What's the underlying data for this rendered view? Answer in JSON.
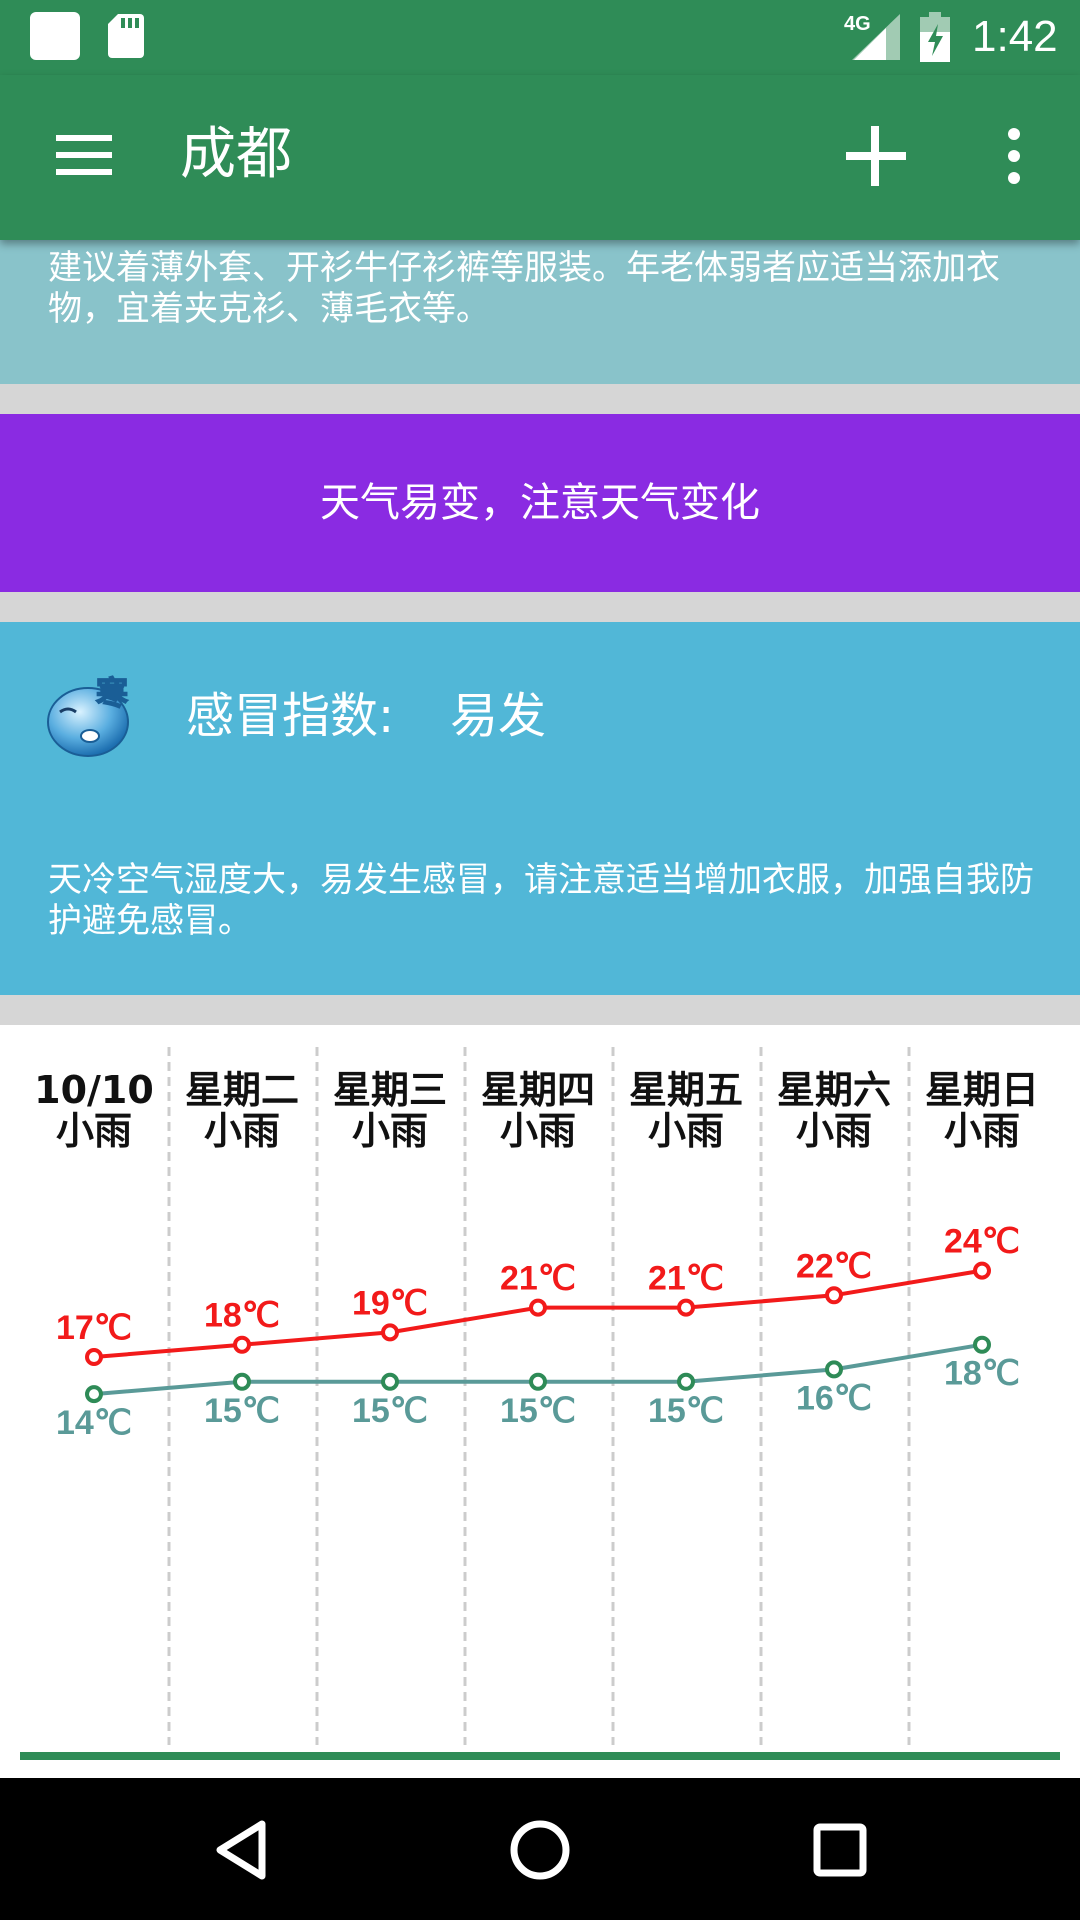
{
  "status_bar": {
    "network": "4G",
    "time": "1:42",
    "icons": [
      "notification-square-icon",
      "sd-card-icon",
      "signal-icon",
      "battery-charging-icon"
    ]
  },
  "app_bar": {
    "title": "成都",
    "icons": [
      "menu-icon",
      "add-icon",
      "more-vert-icon"
    ]
  },
  "dress_card": {
    "description": "建议着薄外套、开衫牛仔衫裤等服装。年老体弱者应适当添加衣物，宜着夹克衫、薄毛衣等。"
  },
  "alert_card": {
    "text": "天气易变，注意天气变化"
  },
  "cold_card": {
    "label": "感冒指数:",
    "value": "易发",
    "icon_glyph": "寒",
    "description": "天冷空气湿度大，易发生感冒，请注意适当增加衣服，加强自我防护避免感冒。"
  },
  "forecast": {
    "days": [
      {
        "day": "10/10",
        "weather": "小雨",
        "high": "17℃",
        "low": "14℃"
      },
      {
        "day": "星期二",
        "weather": "小雨",
        "high": "18℃",
        "low": "15℃"
      },
      {
        "day": "星期三",
        "weather": "小雨",
        "high": "19℃",
        "low": "15℃"
      },
      {
        "day": "星期四",
        "weather": "小雨",
        "high": "21℃",
        "low": "15℃"
      },
      {
        "day": "星期五",
        "weather": "小雨",
        "high": "21℃",
        "low": "15℃"
      },
      {
        "day": "星期六",
        "weather": "小雨",
        "high": "22℃",
        "low": "16℃"
      },
      {
        "day": "星期日",
        "weather": "小雨",
        "high": "24℃",
        "low": "18℃"
      }
    ],
    "colors": {
      "high": "#f21a1a",
      "low": "#5a9a98",
      "low_point": "#2e8b57",
      "divider": "#cccccc",
      "baseline": "#2f8c57"
    }
  },
  "chart_data": {
    "type": "line",
    "categories": [
      "10/10",
      "星期二",
      "星期三",
      "星期四",
      "星期五",
      "星期六",
      "星期日"
    ],
    "series": [
      {
        "values": [
          17,
          18,
          19,
          21,
          21,
          22,
          24
        ]
      },
      {
        "values": [
          14,
          15,
          15,
          15,
          15,
          16,
          18
        ]
      }
    ],
    "data_labels": true,
    "grid": "vertical dashed separators"
  },
  "nav_bar": {
    "icons": [
      "back-icon",
      "home-icon",
      "recents-icon"
    ]
  },
  "colors": {
    "primary": "#2f8c57",
    "dress_bg": "#89c3ca",
    "alert_bg": "#8a2be2",
    "cold_bg": "#51b7d7",
    "separator": "#d6d6d6"
  }
}
